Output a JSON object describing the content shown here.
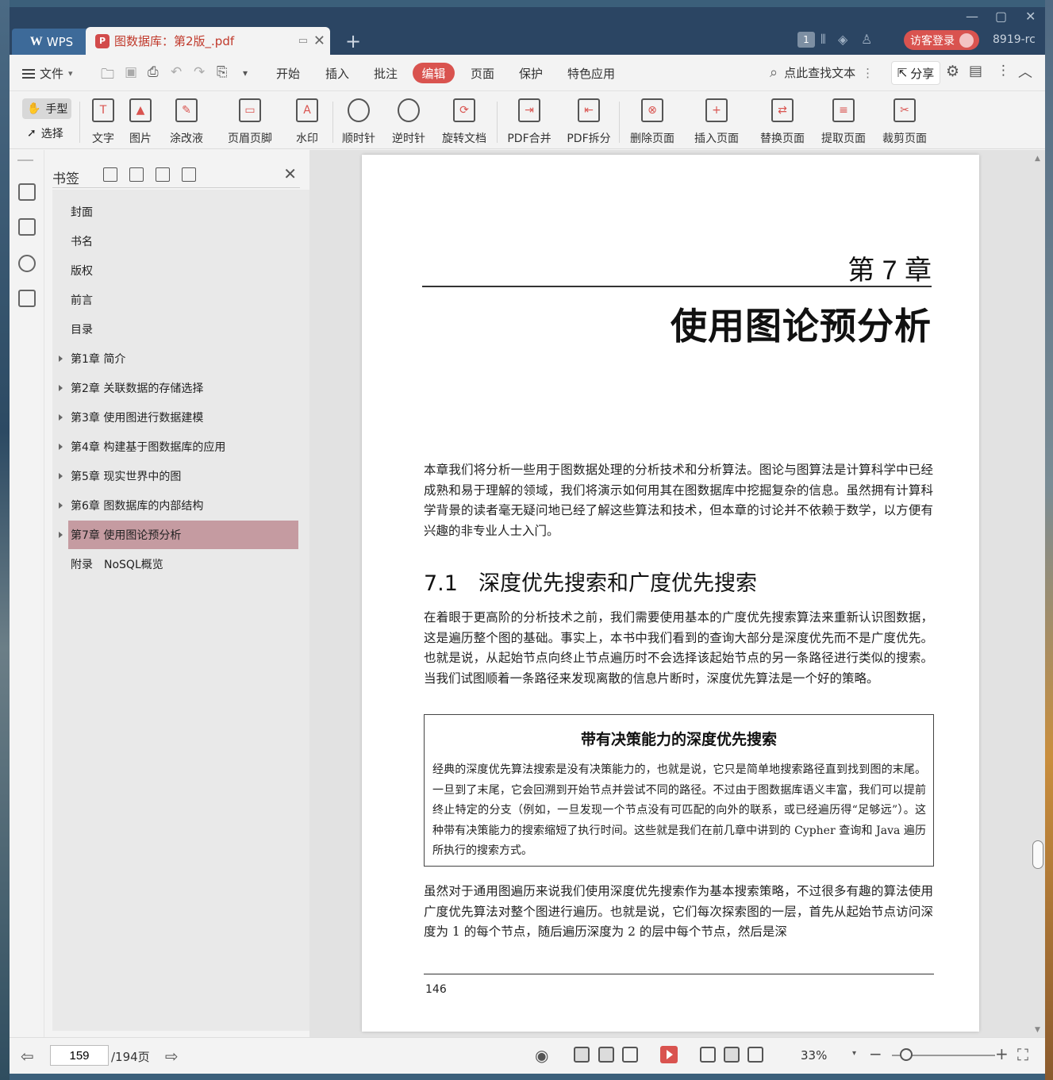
{
  "app": {
    "logo_label": "WPS",
    "brand_color": "#d9534f"
  },
  "tabs": [
    {
      "label": "图数据库：第2版_.pdf"
    }
  ],
  "titlebar": {
    "window_count": "1",
    "login_label": "访客登录",
    "user_id": "8919-rc"
  },
  "menu": {
    "file_label": "文件",
    "items": [
      "开始",
      "插入",
      "批注",
      "编辑",
      "页面",
      "保护",
      "特色应用"
    ],
    "active": "编辑",
    "search_label": "点此查找文本",
    "share_label": "分享"
  },
  "ribbon": {
    "hand_label": "手型",
    "select_label": "选择",
    "buttons": [
      "文字",
      "图片",
      "涂改液",
      "页眉页脚",
      "水印",
      "顺时针",
      "逆时针",
      "旋转文档",
      "PDF合并",
      "PDF拆分",
      "删除页面",
      "插入页面",
      "替换页面",
      "提取页面",
      "裁剪页面"
    ]
  },
  "bookmarks": {
    "title": "书签",
    "items": [
      {
        "label": "封面"
      },
      {
        "label": "书名"
      },
      {
        "label": "版权"
      },
      {
        "label": "前言"
      },
      {
        "label": "目录"
      },
      {
        "label": "第1章 简介"
      },
      {
        "label": "第2章 关联数据的存储选择"
      },
      {
        "label": "第3章 使用图进行数据建模"
      },
      {
        "label": "第4章 构建基于图数据库的应用"
      },
      {
        "label": "第5章 现实世界中的图"
      },
      {
        "label": "第6章 图数据库的内部结构"
      },
      {
        "label": "第7章 使用图论预分析"
      },
      {
        "label": "附录　NoSQL概览"
      }
    ],
    "active_index": 11
  },
  "page": {
    "chapter_no": "第 7 章",
    "chapter_title": "使用图论预分析",
    "intro": "本章我们将分析一些用于图数据处理的分析技术和分析算法。图论与图算法是计算科学中已经成熟和易于理解的领域，我们将演示如何用其在图数据库中挖掘复杂的信息。虽然拥有计算科学背景的读者毫无疑问地已经了解这些算法和技术，但本章的讨论并不依赖于数学，以方便有兴趣的非专业人士入门。",
    "section_num": "7.1",
    "section_title": "深度优先搜索和广度优先搜索",
    "section_para": "在着眼于更高阶的分析技术之前，我们需要使用基本的广度优先搜索算法来重新认识图数据，这是遍历整个图的基础。事实上，本书中我们看到的查询大部分是深度优先而不是广度优先。也就是说，从起始节点向终止节点遍历时不会选择该起始节点的另一条路径进行类似的搜索。当我们试图顺着一条路径来发现离散的信息片断时，深度优先算法是一个好的策略。",
    "box_title": "带有决策能力的深度优先搜索",
    "box_text": "经典的深度优先算法搜索是没有决策能力的，也就是说，它只是简单地搜索路径直到找到图的末尾。一旦到了末尾，它会回溯到开始节点并尝试不同的路径。不过由于图数据库语义丰富，我们可以提前终止特定的分支（例如，一旦发现一个节点没有可匹配的向外的联系，或已经遍历得“足够远”）。这种带有决策能力的搜索缩短了执行时间。这些就是我们在前几章中讲到的 Cypher 查询和 Java 遍历所执行的搜索方式。",
    "closing_para": "虽然对于通用图遍历来说我们使用深度优先搜索作为基本搜索策略，不过很多有趣的算法使用广度优先算法对整个图进行遍历。也就是说，它们每次探索图的一层，首先从起始节点访问深度为 1 的每个节点，随后遍历深度为 2 的层中每个节点，然后是深",
    "page_number": "146"
  },
  "status": {
    "current_page": "159",
    "total_pages": "/194页",
    "zoom": "33%"
  }
}
